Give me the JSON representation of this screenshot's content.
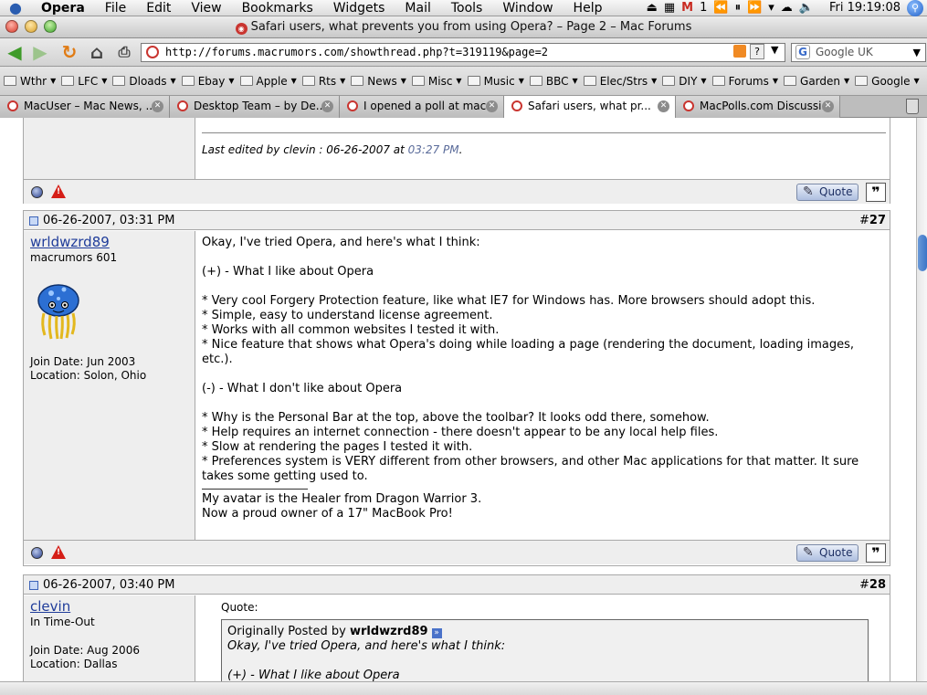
{
  "menubar": {
    "app": "Opera",
    "items": [
      "File",
      "Edit",
      "View",
      "Bookmarks",
      "Widgets",
      "Mail",
      "Tools",
      "Window",
      "Help"
    ],
    "mail_count": "1",
    "clock": "Fri 19:19:08"
  },
  "window": {
    "title": "Safari users, what prevents you from using Opera? – Page 2 – Mac Forums"
  },
  "navbar": {
    "url": "http://forums.macrumors.com/showthread.php?t=319119&page=2",
    "search_placeholder": "Google UK"
  },
  "bookmarks": [
    "Wthr",
    "LFC",
    "Dloads",
    "Ebay",
    "Apple",
    "Rts",
    "News",
    "Misc",
    "Music",
    "BBC",
    "Elec/Strs",
    "DIY",
    "Forums",
    "Garden",
    "Google"
  ],
  "tabs": [
    {
      "label": "MacUser – Mac News, ..."
    },
    {
      "label": "Desktop Team – by De..."
    },
    {
      "label": "I opened a poll at mac..."
    },
    {
      "label": "Safari users, what pr..."
    },
    {
      "label": "MacPolls.com Discussi..."
    }
  ],
  "prev_post": {
    "edited": "Last edited by clevin : 06-26-2007 at ",
    "edited_time": "03:27 PM",
    "quote_label": "Quote"
  },
  "post27": {
    "date": "06-26-2007, 03:31 PM",
    "number_prefix": "#",
    "number": "27",
    "username": "wrldwzrd89",
    "user_title": "macrumors 601",
    "join_date": "Join Date: Jun 2003",
    "location": "Location: Solon, Ohio",
    "message": "Okay, I've tried Opera, and here's what I think:\n\n(+) - What I like about Opera\n\n* Very cool Forgery Protection feature, like what IE7 for Windows has. More browsers should adopt this.\n* Simple, easy to understand license agreement.\n* Works with all common websites I tested it with.\n* Nice feature that shows what Opera's doing while loading a page (rendering the document, loading images, etc.).\n\n(-) - What I don't like about Opera\n\n* Why is the Personal Bar at the top, above the toolbar? It looks odd there, somehow.\n* Help requires an internet connection - there doesn't appear to be any local help files.\n* Slow at rendering the pages I tested it with.\n* Preferences system is VERY different from other browsers, and other Mac applications for that matter. It sure takes some getting used to.",
    "signature": "My avatar is the Healer from Dragon Warrior 3.\nNow a proud owner of a 17\" MacBook Pro!",
    "quote_label": "Quote"
  },
  "post28": {
    "date": "06-26-2007, 03:40 PM",
    "number_prefix": "#",
    "number": "28",
    "username": "clevin",
    "user_title": "In Time-Out",
    "join_date": "Join Date: Aug 2006",
    "location": "Location: Dallas",
    "quote_label": "Quote:",
    "quote_by": "Originally Posted by ",
    "quote_author": "wrldwzrd89",
    "quote_line1": "Okay, I've tried Opera, and here's what I think:",
    "quote_line2": "(+) - What I like about Opera"
  }
}
